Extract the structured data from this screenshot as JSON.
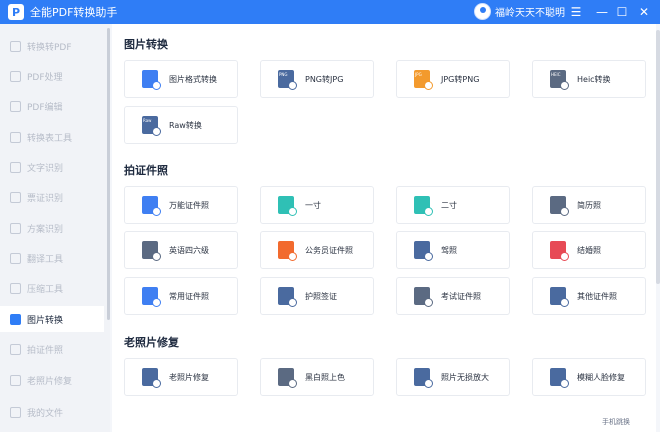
{
  "app": {
    "title": "全能PDF转换助手",
    "logo_letter": "P"
  },
  "user": {
    "name": "福岭天天不聪明"
  },
  "window": {
    "menu_icon": "☰",
    "min_icon": "—",
    "max_icon": "☐",
    "close_icon": "✕"
  },
  "sidebar": {
    "items": [
      {
        "label": "转换转PDF",
        "icon": "convert-icon"
      },
      {
        "label": "PDF处理",
        "icon": "pdf-tool-icon"
      },
      {
        "label": "PDF编辑",
        "icon": "pdf-edit-icon"
      },
      {
        "label": "转换表工具",
        "icon": "table-icon"
      },
      {
        "label": "文字识别",
        "icon": "text-ocr-icon"
      },
      {
        "label": "票证识别",
        "icon": "ticket-icon"
      },
      {
        "label": "方案识别",
        "icon": "scan-icon"
      },
      {
        "label": "翻译工具",
        "icon": "translate-icon"
      },
      {
        "label": "压缩工具",
        "icon": "compress-icon"
      },
      {
        "label": "图片转换",
        "icon": "image-convert-icon",
        "active": true
      },
      {
        "label": "拍证件照",
        "icon": "id-photo-icon"
      },
      {
        "label": "老照片修复",
        "icon": "photo-repair-icon"
      },
      {
        "label": "我的文件",
        "icon": "file-icon"
      }
    ]
  },
  "sections": [
    {
      "title": "图片转换",
      "items": [
        {
          "label": "图片格式转换",
          "icon": "image-format-icon",
          "color": "blue"
        },
        {
          "label": "PNG转JPG",
          "icon": "png-icon",
          "color": "navy",
          "badge": "PNG"
        },
        {
          "label": "JPG转PNG",
          "icon": "jpg-icon",
          "color": "orange",
          "badge": "JPG"
        },
        {
          "label": "Heic转换",
          "icon": "heic-icon",
          "color": "gray",
          "badge": "HEIC"
        },
        {
          "label": "Raw转换",
          "icon": "raw-icon",
          "color": "navy",
          "badge": "Raw"
        }
      ]
    },
    {
      "title": "拍证件照",
      "items": [
        {
          "label": "万能证件照",
          "icon": "id-photo-universal-icon",
          "color": "blue"
        },
        {
          "label": "一寸",
          "icon": "one-inch-icon",
          "color": "teal"
        },
        {
          "label": "二寸",
          "icon": "two-inch-icon",
          "color": "teal"
        },
        {
          "label": "简历照",
          "icon": "resume-photo-icon",
          "color": "gray"
        },
        {
          "label": "英语四六级",
          "icon": "english-exam-icon",
          "color": "gray"
        },
        {
          "label": "公务员证件照",
          "icon": "civil-servant-icon",
          "color": "oreo"
        },
        {
          "label": "驾照",
          "icon": "driver-license-icon",
          "color": "navy"
        },
        {
          "label": "结婚照",
          "icon": "wedding-photo-icon",
          "color": "red"
        },
        {
          "label": "常用证件照",
          "icon": "common-id-icon",
          "color": "blue"
        },
        {
          "label": "护照签证",
          "icon": "passport-icon",
          "color": "navy"
        },
        {
          "label": "考试证件照",
          "icon": "exam-id-icon",
          "color": "gray"
        },
        {
          "label": "其他证件照",
          "icon": "other-id-icon",
          "color": "navy"
        }
      ]
    },
    {
      "title": "老照片修复",
      "items": [
        {
          "label": "老照片修复",
          "icon": "old-photo-icon",
          "color": "navy"
        },
        {
          "label": "黑白照上色",
          "icon": "colorize-icon",
          "color": "gray"
        },
        {
          "label": "照片无损放大",
          "icon": "enlarge-icon",
          "color": "navy"
        },
        {
          "label": "模糊人脸修复",
          "icon": "face-repair-icon",
          "color": "navy"
        }
      ]
    }
  ],
  "footer": {
    "link": "手机跳换"
  }
}
